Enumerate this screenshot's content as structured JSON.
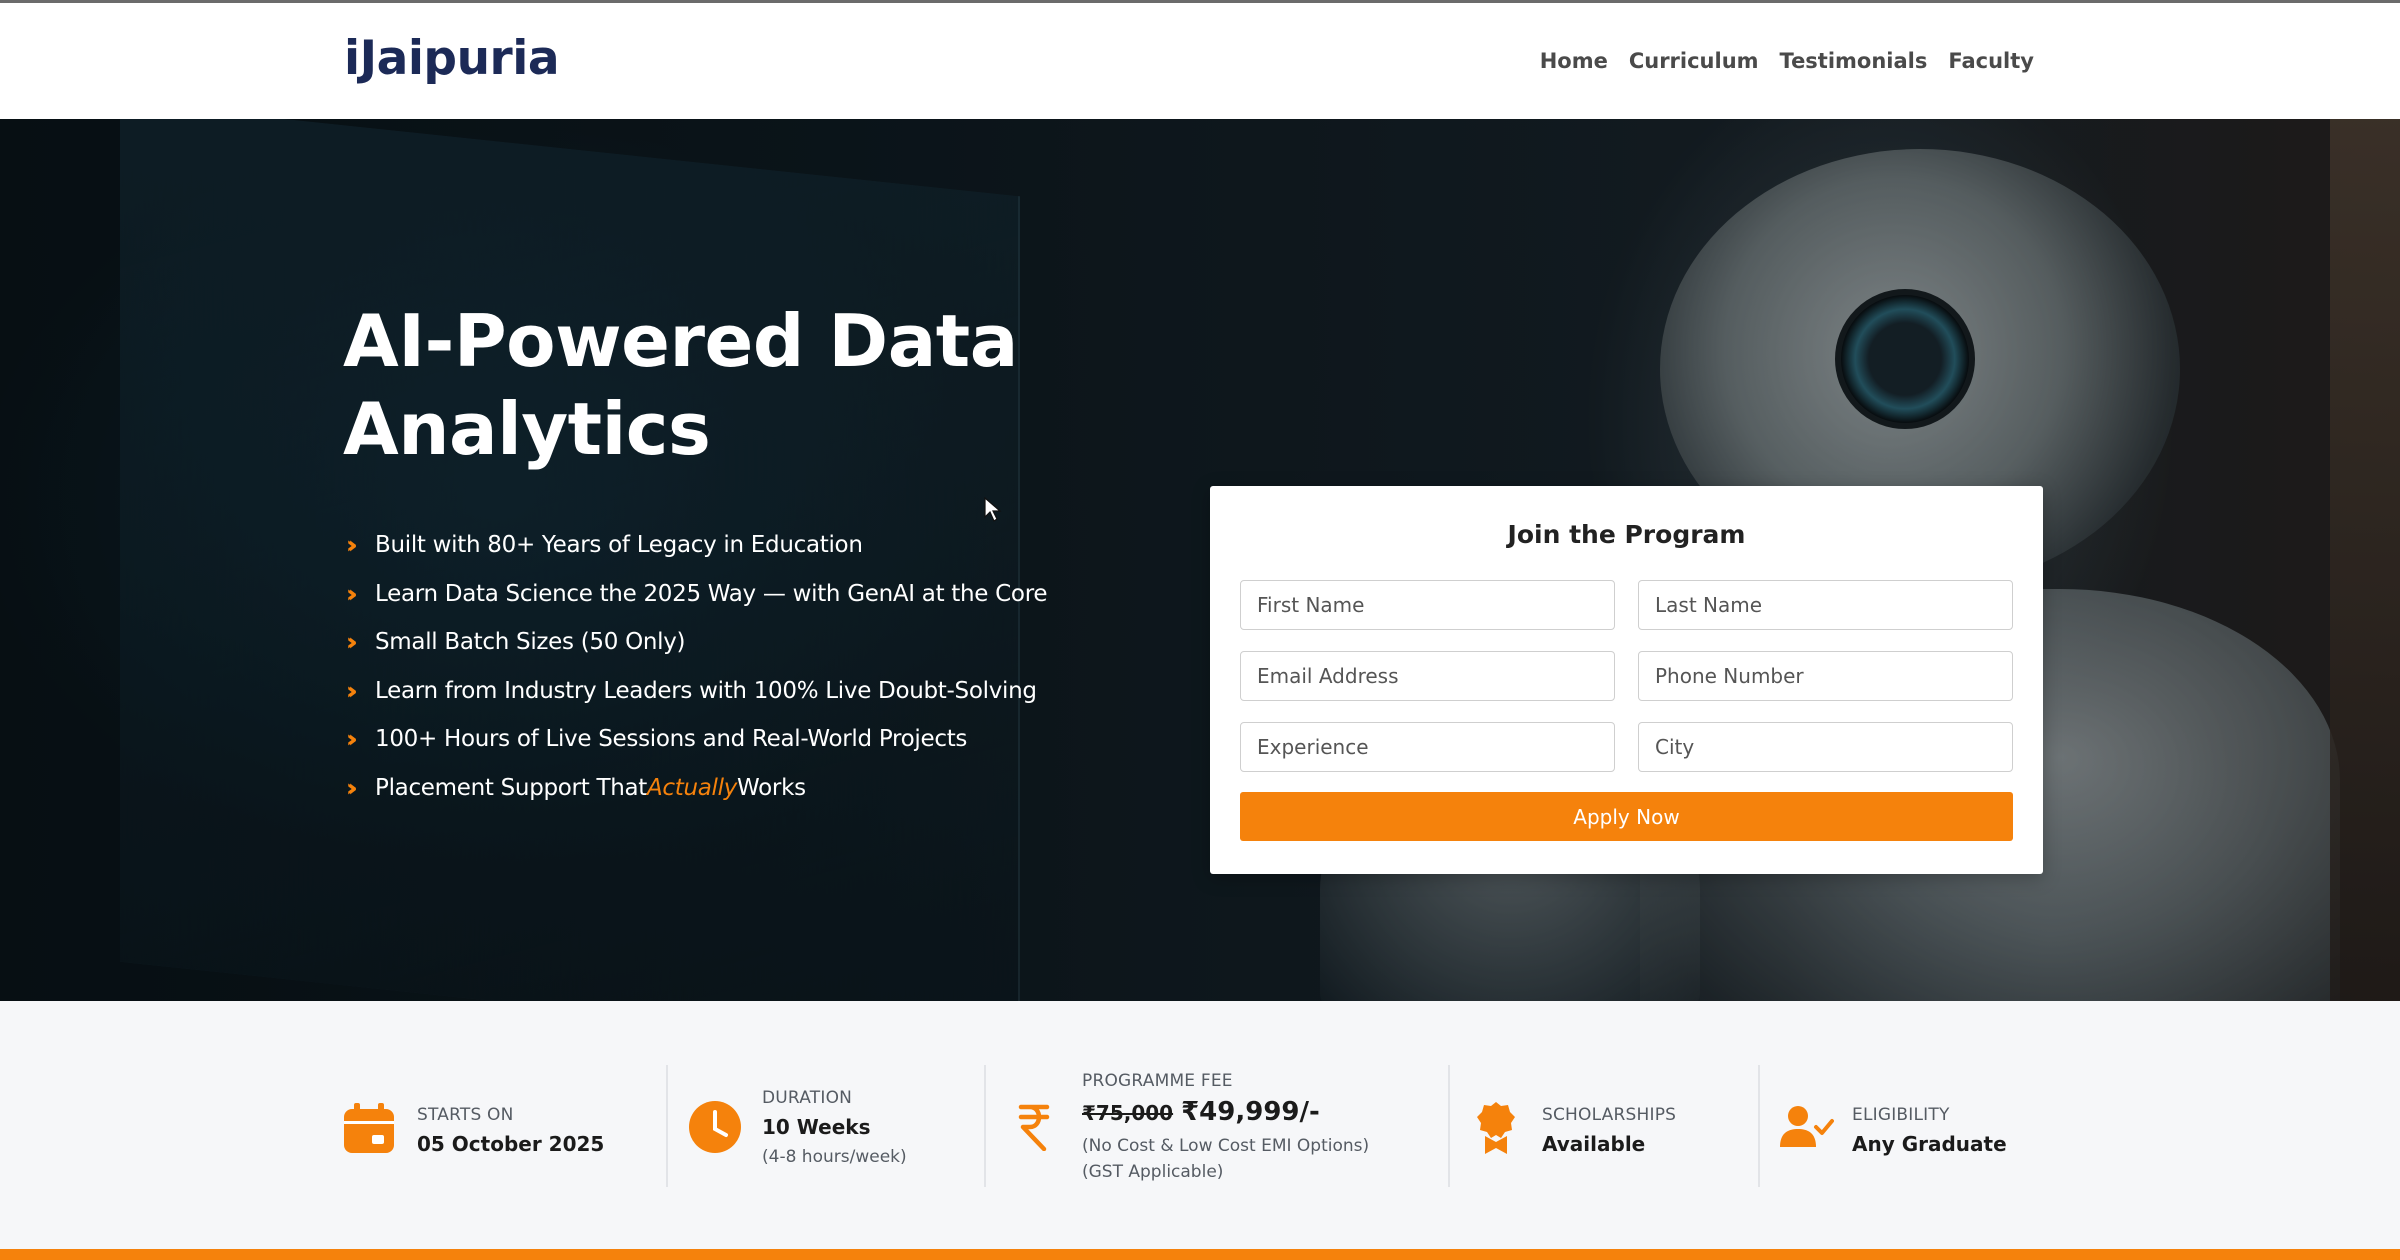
{
  "brand": {
    "logo_text": "iJaipuria",
    "accent_color": "#f5820c",
    "logo_color": "#1c2a57"
  },
  "nav": {
    "items": [
      "Home",
      "Curriculum",
      "Testimonials",
      "Faculty"
    ]
  },
  "hero": {
    "title_line1": "AI-Powered Data",
    "title_line2": "Analytics",
    "features": [
      "Built with 80+ Years of Legacy in Education",
      "Learn Data Science the 2025 Way — with GenAI at the Core",
      "Small Batch Sizes (50 Only)",
      "Learn from Industry Leaders with 100% Live Doubt-Solving",
      "100+ Hours of Live Sessions and Real-World Projects"
    ],
    "feature_last": {
      "before": "Placement Support That ",
      "accent": "Actually",
      "after": " Works"
    },
    "background_image": "robot-and-data-dashboard"
  },
  "form": {
    "title": "Join the Program",
    "first_name_placeholder": "First Name",
    "last_name_placeholder": "Last Name",
    "email_placeholder": "Email Address",
    "phone_placeholder": "Phone Number",
    "experience_placeholder": "Experience",
    "city_placeholder": "City",
    "submit_label": "Apply Now"
  },
  "info": {
    "starts": {
      "label": "STARTS ON",
      "value": "05 October 2025",
      "icon": "calendar-icon"
    },
    "duration": {
      "label": "DURATION",
      "value": "10 Weeks",
      "sub": "(4-8 hours/week)",
      "icon": "clock-icon"
    },
    "fee": {
      "label": "PROGRAMME FEE",
      "old_price": "₹75,000",
      "price": "₹49,999/-",
      "sub1": "(No Cost & Low Cost EMI Options)",
      "sub2": "(GST Applicable)",
      "icon": "rupee-icon"
    },
    "scholarships": {
      "label": "SCHOLARSHIPS",
      "value": "Available",
      "icon": "badge-icon"
    },
    "eligibility": {
      "label": "ELIGIBILITY",
      "value": "Any Graduate",
      "icon": "user-check-icon"
    }
  }
}
